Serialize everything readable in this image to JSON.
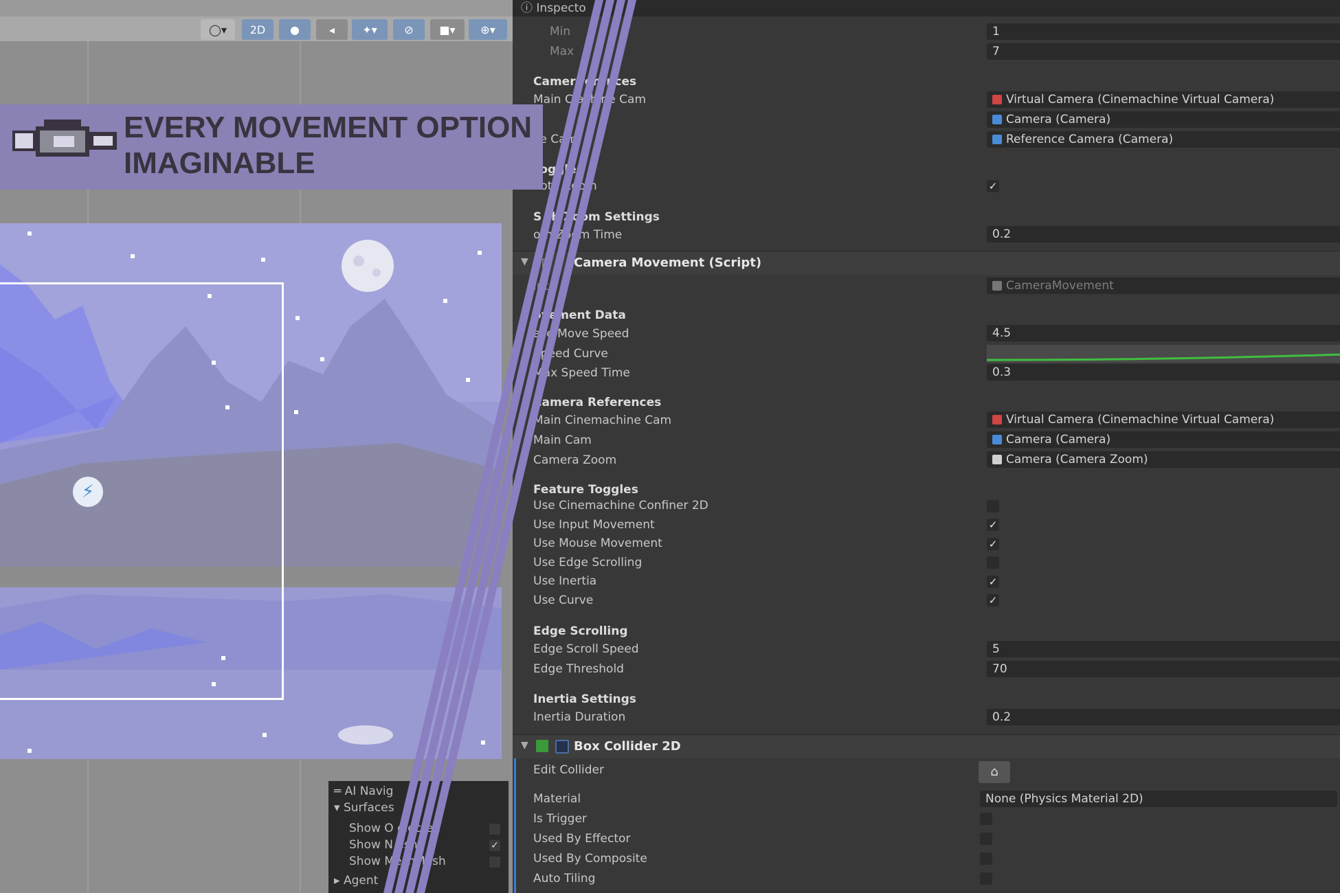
{
  "scene": {
    "toolbar": {
      "mode_2d_label": "2D"
    },
    "banner": {
      "title": "EVERY MOVEMENT OPTION\nIMAGINABLE"
    },
    "ai_navigation": {
      "title": "AI Navig",
      "surfaces_label": "Surfaces",
      "items": [
        {
          "label": "Show O   elected",
          "checked": false
        },
        {
          "label": "Show N   esh",
          "checked": true
        },
        {
          "label": "Show      MeshMesh",
          "checked": false
        }
      ],
      "agents_label": "Agent"
    }
  },
  "inspector": {
    "tab_title": "Inspecto",
    "top_block": {
      "min_label": "Min",
      "min_value": "1",
      "max_label": "Max",
      "max_value": "7",
      "camera_references_head": "Camer   ferences",
      "main_cinemachine_cam_label": "Main C   achine Cam",
      "main_cinemachine_cam_value": "Virtual Camera (Cinemachine Virtual Camera)",
      "main_cam_value": "Camera (Camera)",
      "reference_cam_label": "   ce Cam",
      "reference_cam_value": "Reference Camera (Camera)",
      "toggles_head": "   Toggles",
      "smooth_zoom_label": "   ooth Zoom",
      "smooth_zoom_settings_head": "S   th Zoom Settings",
      "smooth_zoom_time_label": "   oth Zoom Time",
      "smooth_zoom_time_value": "0.2"
    },
    "camera_movement": {
      "title": "Camera Movement (Script)",
      "script_label": "   ipt",
      "script_value": "CameraMovement",
      "movement_data_head": "ovement Data",
      "base_move_speed_label": "ase Move Speed",
      "base_move_speed_value": "4.5",
      "speed_curve_label": "Speed Curve",
      "max_speed_time_label": "Max Speed Time",
      "max_speed_time_value": "0.3",
      "camera_references_head": "Camera References",
      "main_cinemachine_cam_label": "Main Cinemachine Cam",
      "main_cinemachine_cam_value": "Virtual Camera (Cinemachine Virtual Camera)",
      "main_cam_label": "Main Cam",
      "main_cam_value": "Camera (Camera)",
      "camera_zoom_label": "Camera Zoom",
      "camera_zoom_value": "Camera (Camera Zoom)",
      "feature_toggles_head": "Feature Toggles",
      "toggles": [
        {
          "label": "Use Cinemachine Confiner 2D",
          "checked": false
        },
        {
          "label": "Use Input Movement",
          "checked": true
        },
        {
          "label": "Use Mouse Movement",
          "checked": true
        },
        {
          "label": "Use Edge Scrolling",
          "checked": false
        },
        {
          "label": "Use Inertia",
          "checked": true
        },
        {
          "label": "Use Curve",
          "checked": true
        }
      ],
      "edge_scrolling_head": "Edge Scrolling",
      "edge_scroll_speed_label": "Edge Scroll Speed",
      "edge_scroll_speed_value": "5",
      "edge_threshold_label": "Edge Threshold",
      "edge_threshold_value": "70",
      "inertia_settings_head": "Inertia Settings",
      "inertia_duration_label": "Inertia Duration",
      "inertia_duration_value": "0.2"
    },
    "box_collider": {
      "title": "Box Collider 2D",
      "edit_collider_label": "Edit Collider",
      "material_label": "Material",
      "material_value": "None (Physics Material 2D)",
      "is_trigger_label": "Is Trigger",
      "used_by_effector_label": "Used By Effector",
      "used_by_composite_label": "Used By Composite",
      "auto_tiling_label": "Auto Tiling"
    }
  },
  "colors": {
    "banner_bg": "#8a82b4",
    "stripe": "#8a7fc0",
    "inspector_bg": "#383838",
    "curve_green": "#3fbf3f"
  }
}
